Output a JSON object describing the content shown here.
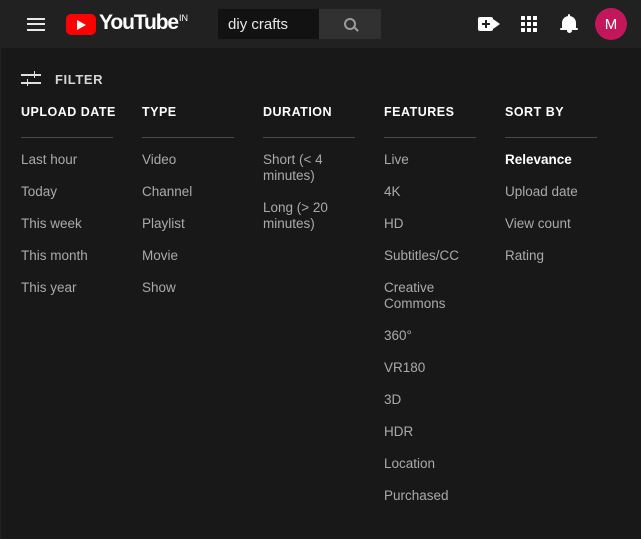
{
  "masthead": {
    "guide_label": "Guide",
    "logo": {
      "word": "YouTube",
      "country_code": "IN"
    },
    "search": {
      "value": "diy crafts",
      "placeholder": "Search",
      "button_label": "Search"
    },
    "actions": [
      {
        "name": "create-video",
        "label": "Create"
      },
      {
        "name": "apps-grid",
        "label": "YouTube apps"
      },
      {
        "name": "notifications",
        "label": "Notifications"
      }
    ],
    "avatar": {
      "initial": "M",
      "color": "#c2185b"
    }
  },
  "filter": {
    "toggle_label": "FILTER",
    "columns": [
      {
        "title": "UPLOAD DATE",
        "options": [
          {
            "label": "Last hour",
            "selected": false
          },
          {
            "label": "Today",
            "selected": false
          },
          {
            "label": "This week",
            "selected": false
          },
          {
            "label": "This month",
            "selected": false
          },
          {
            "label": "This year",
            "selected": false
          }
        ]
      },
      {
        "title": "TYPE",
        "options": [
          {
            "label": "Video",
            "selected": false
          },
          {
            "label": "Channel",
            "selected": false
          },
          {
            "label": "Playlist",
            "selected": false
          },
          {
            "label": "Movie",
            "selected": false
          },
          {
            "label": "Show",
            "selected": false
          }
        ]
      },
      {
        "title": "DURATION",
        "options": [
          {
            "label": "Short (< 4 minutes)",
            "selected": false
          },
          {
            "label": "Long (> 20 minutes)",
            "selected": false
          }
        ]
      },
      {
        "title": "FEATURES",
        "options": [
          {
            "label": "Live",
            "selected": false
          },
          {
            "label": "4K",
            "selected": false
          },
          {
            "label": "HD",
            "selected": false
          },
          {
            "label": "Subtitles/CC",
            "selected": false
          },
          {
            "label": "Creative Commons",
            "selected": false
          },
          {
            "label": "360°",
            "selected": false
          },
          {
            "label": "VR180",
            "selected": false
          },
          {
            "label": "3D",
            "selected": false
          },
          {
            "label": "HDR",
            "selected": false
          },
          {
            "label": "Location",
            "selected": false
          },
          {
            "label": "Purchased",
            "selected": false
          }
        ]
      },
      {
        "title": "SORT BY",
        "options": [
          {
            "label": "Relevance",
            "selected": true
          },
          {
            "label": "Upload date",
            "selected": false
          },
          {
            "label": "View count",
            "selected": false
          },
          {
            "label": "Rating",
            "selected": false
          }
        ]
      }
    ]
  },
  "theme": {
    "page_bg": "#181818",
    "masthead_bg": "#212121",
    "search_bg": "#121212",
    "search_button_bg": "#313131",
    "brand_red": "#ff0000",
    "text_primary": "#ffffff",
    "text_secondary": "#aaaaaa",
    "rule": "#4a4a4a"
  }
}
